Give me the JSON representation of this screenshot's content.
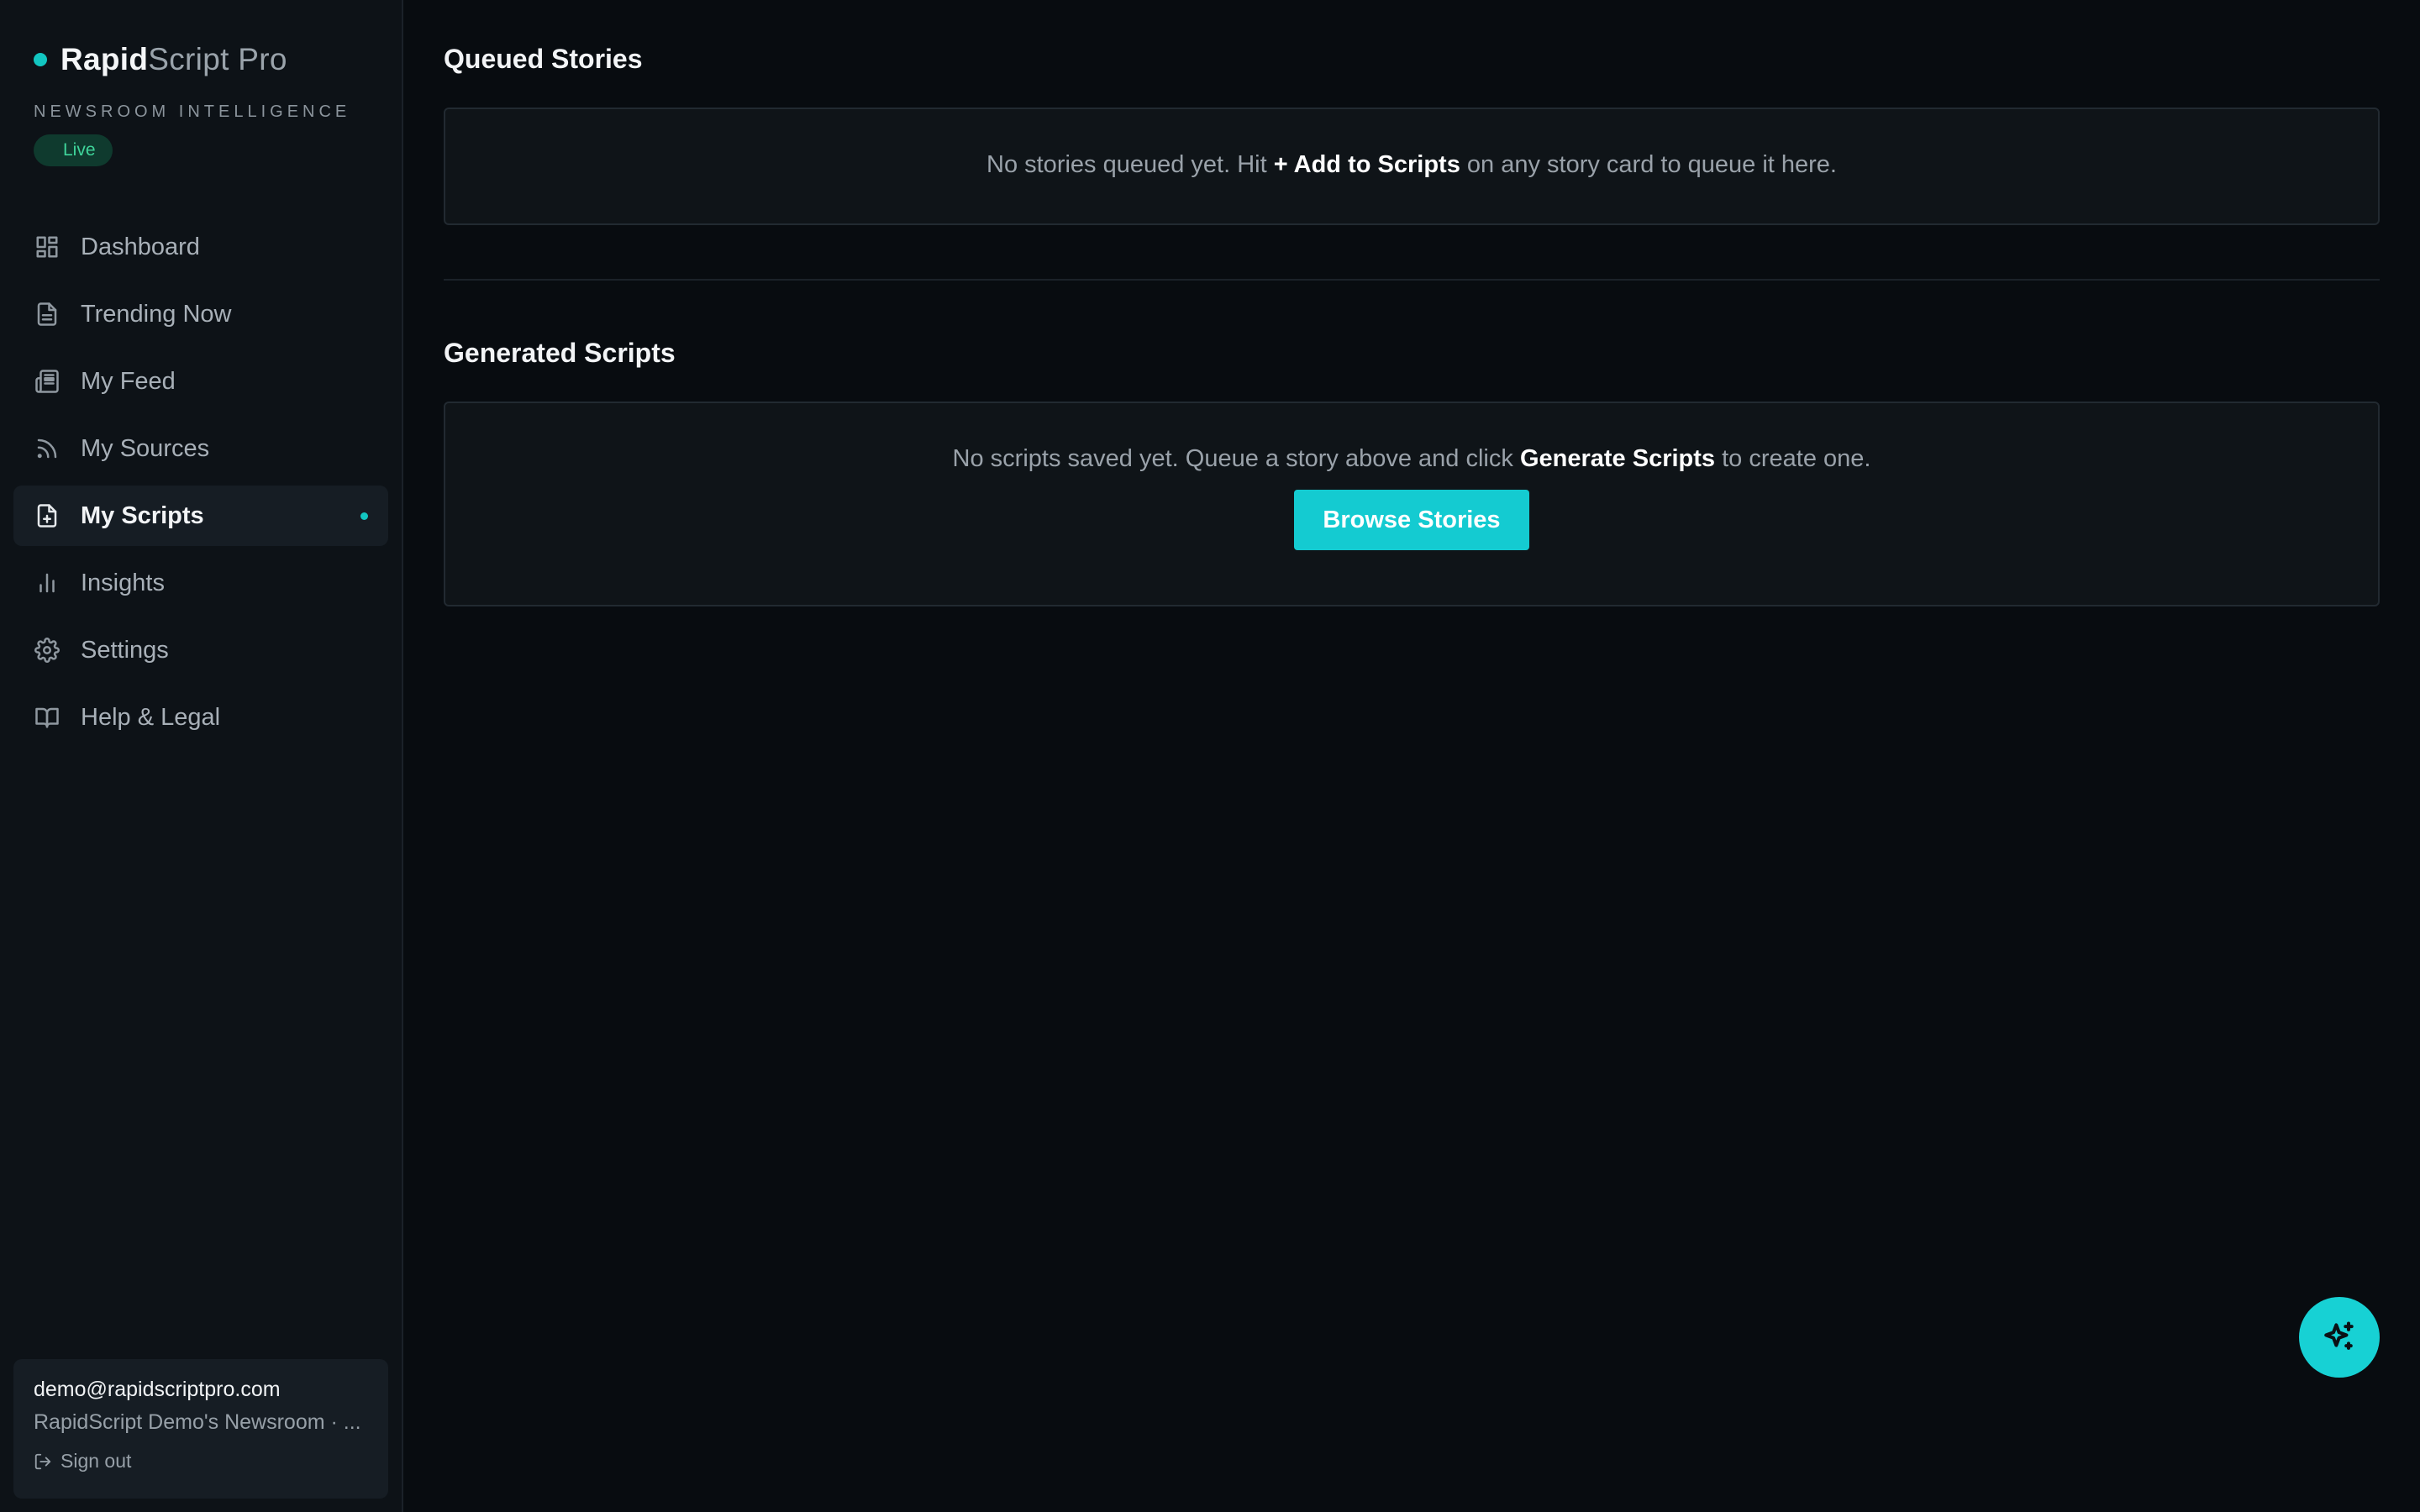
{
  "brand": {
    "name_part1": "Rapid",
    "name_part2": "Script Pro",
    "tagline": "NEWSROOM INTELLIGENCE",
    "status": "Live",
    "accent_color": "#12c6c1"
  },
  "nav": {
    "items": [
      {
        "label": "Dashboard",
        "icon": "dashboard-icon",
        "active": false
      },
      {
        "label": "Trending Now",
        "icon": "document-icon",
        "active": false
      },
      {
        "label": "My Feed",
        "icon": "newspaper-icon",
        "active": false
      },
      {
        "label": "My Sources",
        "icon": "rss-icon",
        "active": false
      },
      {
        "label": "My Scripts",
        "icon": "file-plus-icon",
        "active": true
      },
      {
        "label": "Insights",
        "icon": "bar-chart-icon",
        "active": false
      },
      {
        "label": "Settings",
        "icon": "gear-icon",
        "active": false
      },
      {
        "label": "Help & Legal",
        "icon": "book-icon",
        "active": false
      }
    ]
  },
  "account": {
    "email": "demo@rapidscriptpro.com",
    "org": "RapidScript Demo's Newsroom · ...",
    "signout_label": "Sign out"
  },
  "queued": {
    "title": "Queued Stories",
    "empty_prefix": "No stories queued yet. Hit ",
    "empty_action": "+ Add to Scripts",
    "empty_suffix": " on any story card to queue it here."
  },
  "generated": {
    "title": "Generated Scripts",
    "empty_prefix": "No scripts saved yet. Queue a story above and click ",
    "empty_action": "Generate Scripts",
    "empty_suffix": " to create one.",
    "button_label": "Browse Stories"
  },
  "fab": {
    "icon": "sparkles-icon"
  }
}
